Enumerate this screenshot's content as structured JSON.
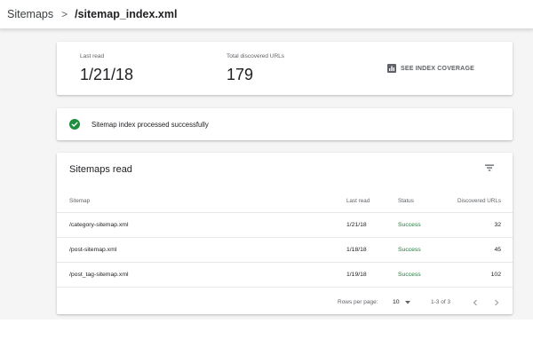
{
  "breadcrumb": {
    "root": "Sitemaps",
    "separator": ">",
    "current": "/sitemap_index.xml"
  },
  "stats": {
    "last_read_label": "Last read",
    "last_read_value": "1/21/18",
    "total_label": "Total discovered URLs",
    "total_value": "179",
    "coverage_link": "SEE INDEX COVERAGE"
  },
  "banner": {
    "message": "Sitemap index processed successfully"
  },
  "table": {
    "title": "Sitemaps read",
    "columns": [
      "Sitemap",
      "Last read",
      "Status",
      "Discovered URLs"
    ],
    "rows": [
      {
        "sitemap": "/category-sitemap.xml",
        "last_read": "1/21/18",
        "status": "Success",
        "urls": "32"
      },
      {
        "sitemap": "/post-sitemap.xml",
        "last_read": "1/18/18",
        "status": "Success",
        "urls": "45"
      },
      {
        "sitemap": "/post_tag-sitemap.xml",
        "last_read": "1/19/18",
        "status": "Success",
        "urls": "102"
      }
    ],
    "footer": {
      "rows_per_page_label": "Rows per page:",
      "rows_per_page_value": "10",
      "range": "1-3 of 3"
    }
  },
  "colors": {
    "success": "#188038",
    "check": "#1e8e3e",
    "muted": "#5f6368"
  },
  "icons": {
    "coverage": "bar-chart-icon",
    "banner": "check-circle-icon",
    "filter": "filter-icon",
    "dropdown": "caret-down-icon",
    "prev": "chevron-left-icon",
    "next": "chevron-right-icon"
  }
}
